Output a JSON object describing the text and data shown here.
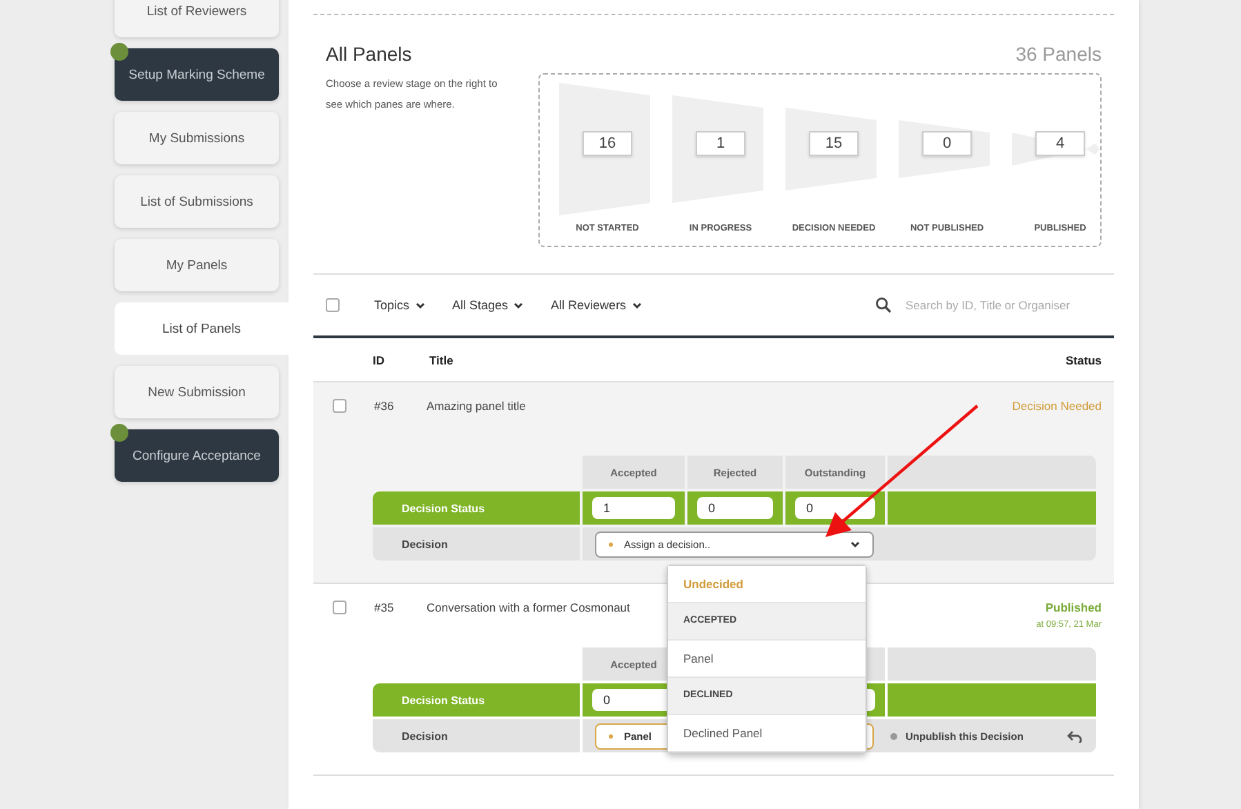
{
  "sidebar": {
    "items": [
      {
        "label": "List of Reviewers",
        "selected": false,
        "dark": false
      },
      {
        "label": "Setup Marking Scheme",
        "selected": false,
        "dark": true
      },
      {
        "label": "My Submissions",
        "selected": false,
        "dark": false
      },
      {
        "label": "List of Submissions",
        "selected": false,
        "dark": false
      },
      {
        "label": "My Panels",
        "selected": false,
        "dark": false
      },
      {
        "label": "List of Panels",
        "selected": true,
        "dark": false
      },
      {
        "label": "New Submission",
        "selected": false,
        "dark": false
      },
      {
        "label": "Configure Acceptance",
        "selected": false,
        "dark": true
      }
    ]
  },
  "header": {
    "title": "All Panels",
    "count": "36 Panels",
    "description": "Choose a review stage on the right to see which panes are where."
  },
  "stages": [
    {
      "label": "NOT STARTED",
      "value": "16"
    },
    {
      "label": "IN PROGRESS",
      "value": "1"
    },
    {
      "label": "DECISION NEEDED",
      "value": "15"
    },
    {
      "label": "NOT PUBLISHED",
      "value": "0"
    },
    {
      "label": "PUBLISHED",
      "value": "4"
    }
  ],
  "filters": {
    "select_all_checked": false,
    "dropdowns": [
      "Topics",
      "All Stages",
      "All Reviewers"
    ],
    "search": {
      "placeholder": "Search by ID, Title or Organiser"
    }
  },
  "table": {
    "columns": [
      "ID",
      "Title",
      "Status"
    ],
    "rows": [
      {
        "id": "#36",
        "title": "Amazing panel title",
        "checked": false,
        "expanded": true,
        "status": {
          "label": "Decision Needed",
          "kind": "pending"
        },
        "detail": {
          "columns": [
            "Accepted",
            "Rejected",
            "Outstanding"
          ],
          "status_label": "Decision Status",
          "values": [
            "1",
            "0",
            "0"
          ],
          "decision_label": "Decision",
          "decision": {
            "value": "Assign a decision..",
            "kind": "placeholder"
          },
          "dropdown": {
            "items": [
              {
                "kind": "option",
                "label": "Undecided",
                "selected": true
              },
              {
                "kind": "group",
                "label": "ACCEPTED"
              },
              {
                "kind": "option",
                "label": "Panel",
                "selected": false
              },
              {
                "kind": "group",
                "label": "DECLINED"
              },
              {
                "kind": "option",
                "label": "Declined Panel",
                "selected": false
              }
            ]
          }
        }
      },
      {
        "id": "#35",
        "title": "Conversation with a former Cosmonaut",
        "checked": false,
        "expanded": false,
        "status": {
          "label": "Published",
          "time": "at 09:57, 21 Mar",
          "kind": "published"
        },
        "detail": {
          "columns": [
            "Accepted"
          ],
          "status_label": "Decision Status",
          "values": [
            "0"
          ],
          "decision_label": "Decision",
          "decision": {
            "value": "Panel",
            "kind": "chosen"
          },
          "action": {
            "label": "Unpublish this Decision"
          }
        }
      }
    ]
  }
}
